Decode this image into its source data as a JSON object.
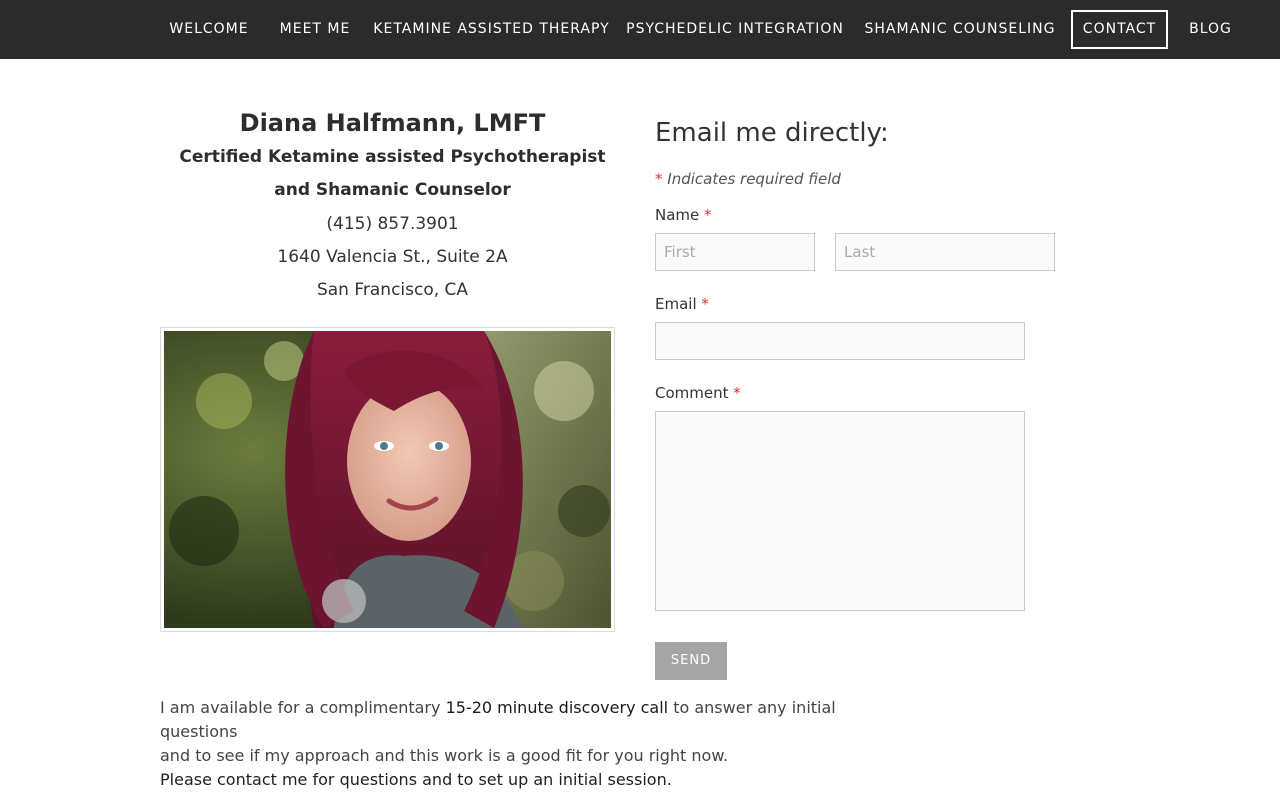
{
  "nav": {
    "items": [
      {
        "label": "WELCOME"
      },
      {
        "label": "MEET ME"
      },
      {
        "label": "KETAMINE ASSISTED THERAPY"
      },
      {
        "label": "PSYCHEDELIC INTEGRATION"
      },
      {
        "label": "SHAMANIC COUNSELING"
      },
      {
        "label": "CONTACT",
        "active": true
      },
      {
        "label": "BLOG"
      }
    ]
  },
  "profile": {
    "name": "Diana Halfmann, LMFT",
    "subtitle_line1": "Certified Ketamine assisted Psychotherapist",
    "subtitle_line2": "and Shamanic Counselor",
    "phone": "(415) 857.3901",
    "address_line1": "1640 Valencia St., Suite 2A",
    "address_line2": "San Francisco, CA"
  },
  "form": {
    "heading": "Email me directly:",
    "required_star": "*",
    "required_note": "Indicates required field",
    "name_label": "Name",
    "first_placeholder": "First",
    "last_placeholder": "Last",
    "email_label": "Email",
    "comment_label": "Comment",
    "send_label": "SEND"
  },
  "body": {
    "para1_before": "I am available for a complimentary ",
    "para1_bold": "15-20 minute discovery call",
    "para1_after": " to answer any initial questions",
    "para1_line2": "and to see if my approach and this work is a good fit for you right now.",
    "para2": "Please contact me for questions and to set up an initial session."
  },
  "colors": {
    "nav_bg": "#2b2b2b",
    "required": "#dd3333",
    "button_bg": "#a5a5a5"
  }
}
